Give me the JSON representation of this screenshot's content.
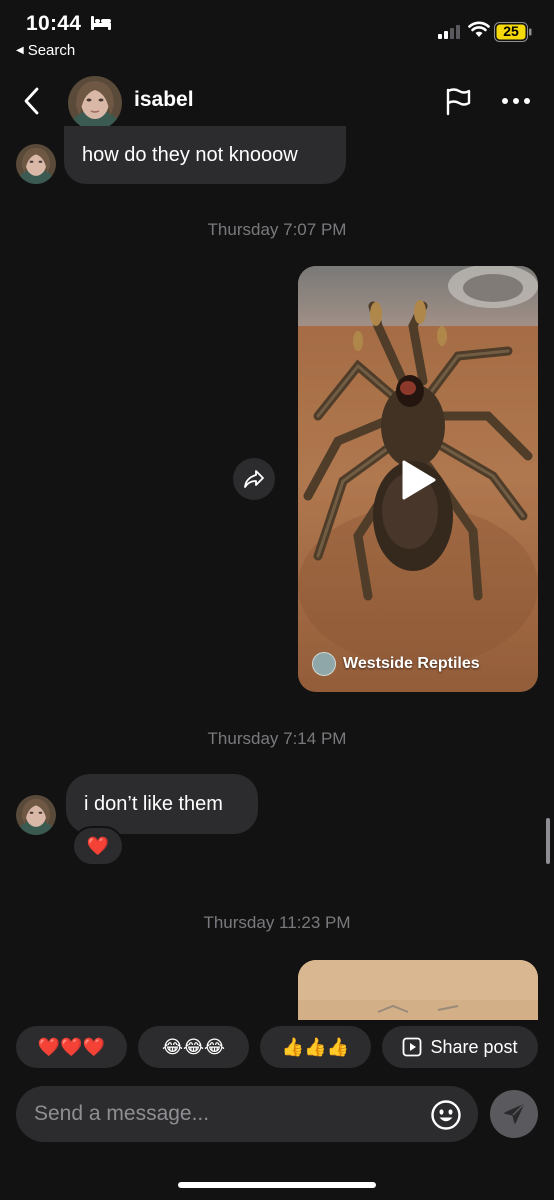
{
  "status_bar": {
    "time": "10:44",
    "back_app_label": "Search",
    "battery_level": "25",
    "battery_color": "#f5d90a"
  },
  "header": {
    "contact_name": "isabel",
    "back_icon": "chevron-left-icon",
    "flag_icon": "flag-icon",
    "more_icon": "more-horizontal-icon"
  },
  "messages": [
    {
      "type": "text",
      "direction": "incoming",
      "text": "how do they not knooow"
    },
    {
      "type": "timestamp",
      "text": "Thursday 7:07 PM"
    },
    {
      "type": "video",
      "direction": "outgoing",
      "creator": "Westside Reptiles"
    },
    {
      "type": "timestamp",
      "text": "Thursday 7:14 PM"
    },
    {
      "type": "text",
      "direction": "incoming",
      "text": "i don’t like them",
      "reaction": "❤️"
    },
    {
      "type": "timestamp",
      "text": "Thursday 11:23 PM"
    },
    {
      "type": "video",
      "direction": "outgoing",
      "partial": true
    }
  ],
  "quick_replies": {
    "hearts": "❤️❤️❤️",
    "laughs": "😂😂😂",
    "thumbs": "👍👍👍",
    "share_post": "Share post"
  },
  "composer": {
    "placeholder": "Send a message...",
    "emoji_icon": "smiley-icon",
    "send_icon": "send-icon"
  },
  "colors": {
    "background": "#121212",
    "bubble": "#2c2c2e",
    "timestamp": "#7a7a7e"
  }
}
